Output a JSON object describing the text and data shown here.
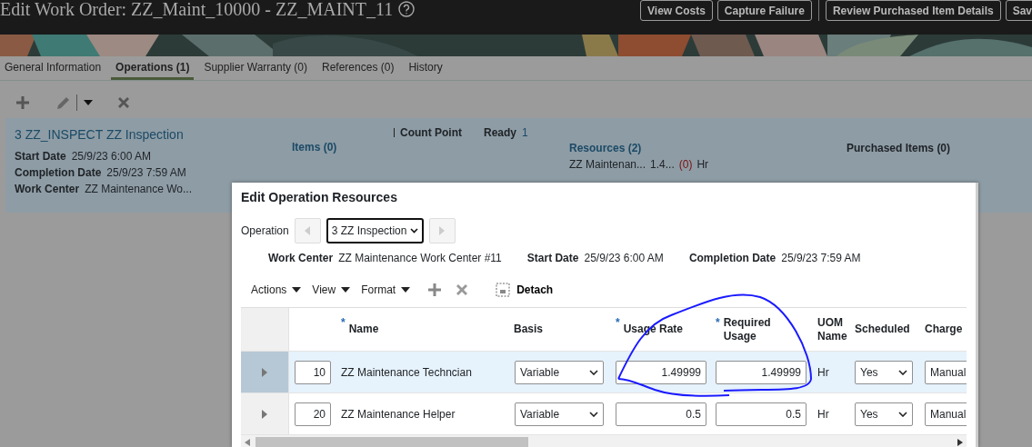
{
  "header": {
    "title": "Edit Work Order: ZZ_Maint_10000 - ZZ_MAINT_11",
    "buttons": [
      {
        "label": "View Costs",
        "separator_before": false
      },
      {
        "label": "Capture Failure",
        "separator_before": false
      },
      {
        "label": "Review Purchased Item Details",
        "separator_before": true
      },
      {
        "label": "Sav",
        "separator_before": false
      }
    ]
  },
  "tabs": [
    {
      "label": "General Information",
      "selected": false
    },
    {
      "label": "Operations (1)",
      "selected": true
    },
    {
      "label": "Supplier Warranty (0)",
      "selected": false
    },
    {
      "label": "References (0)",
      "selected": false
    },
    {
      "label": "History",
      "selected": false
    }
  ],
  "operation": {
    "title": "3 ZZ_INSPECT ZZ Inspection",
    "fields": [
      {
        "label": "Start Date",
        "value": "25/9/23 6:00 AM"
      },
      {
        "label": "Completion Date",
        "value": "25/9/23 7:59 AM"
      },
      {
        "label": "Work Center",
        "value": "ZZ Maintenance Wo..."
      }
    ],
    "count_point": "Count Point",
    "ready_label": "Ready",
    "ready_value": "1",
    "items": "Items (0)",
    "resources": "Resources (2)",
    "resource_lines": [
      {
        "name": "ZZ Maintenan...",
        "usage": "1.4...",
        "count": "(0)",
        "uom": "Hr"
      }
    ],
    "purchased_items": "Purchased Items (0)"
  },
  "dialog": {
    "title": "Edit Operation Resources",
    "operation_label": "Operation",
    "operation_value": "3 ZZ Inspection",
    "info": [
      {
        "label": "Work Center",
        "value": "ZZ Maintenance Work Center #11"
      },
      {
        "label": "Start Date",
        "value": "25/9/23 6:00 AM"
      },
      {
        "label": "Completion Date",
        "value": "25/9/23 7:59 AM"
      }
    ],
    "menus": [
      "Actions",
      "View",
      "Format"
    ],
    "detach": "Detach",
    "columns": [
      {
        "label": "Name",
        "mark": "*"
      },
      {
        "label": "Basis"
      },
      {
        "label": "Usage Rate",
        "mark": "*"
      },
      {
        "label": "Required Usage",
        "mark": "*"
      },
      {
        "label": "UOM Name"
      },
      {
        "label": "Scheduled"
      },
      {
        "label": "Charge"
      }
    ],
    "rows": [
      {
        "selected": true,
        "seq": "10",
        "name": "ZZ Maintenance Techncian",
        "basis": "Variable",
        "usage_rate": "1.49999",
        "required_usage": "1.49999",
        "uom": "Hr",
        "scheduled": "Yes",
        "charge": "Manual"
      },
      {
        "selected": false,
        "seq": "20",
        "name": "ZZ Maintenance Helper",
        "basis": "Variable",
        "usage_rate": "0.5",
        "required_usage": "0.5",
        "uom": "Hr",
        "scheduled": "Yes",
        "charge": "Manual"
      }
    ]
  }
}
